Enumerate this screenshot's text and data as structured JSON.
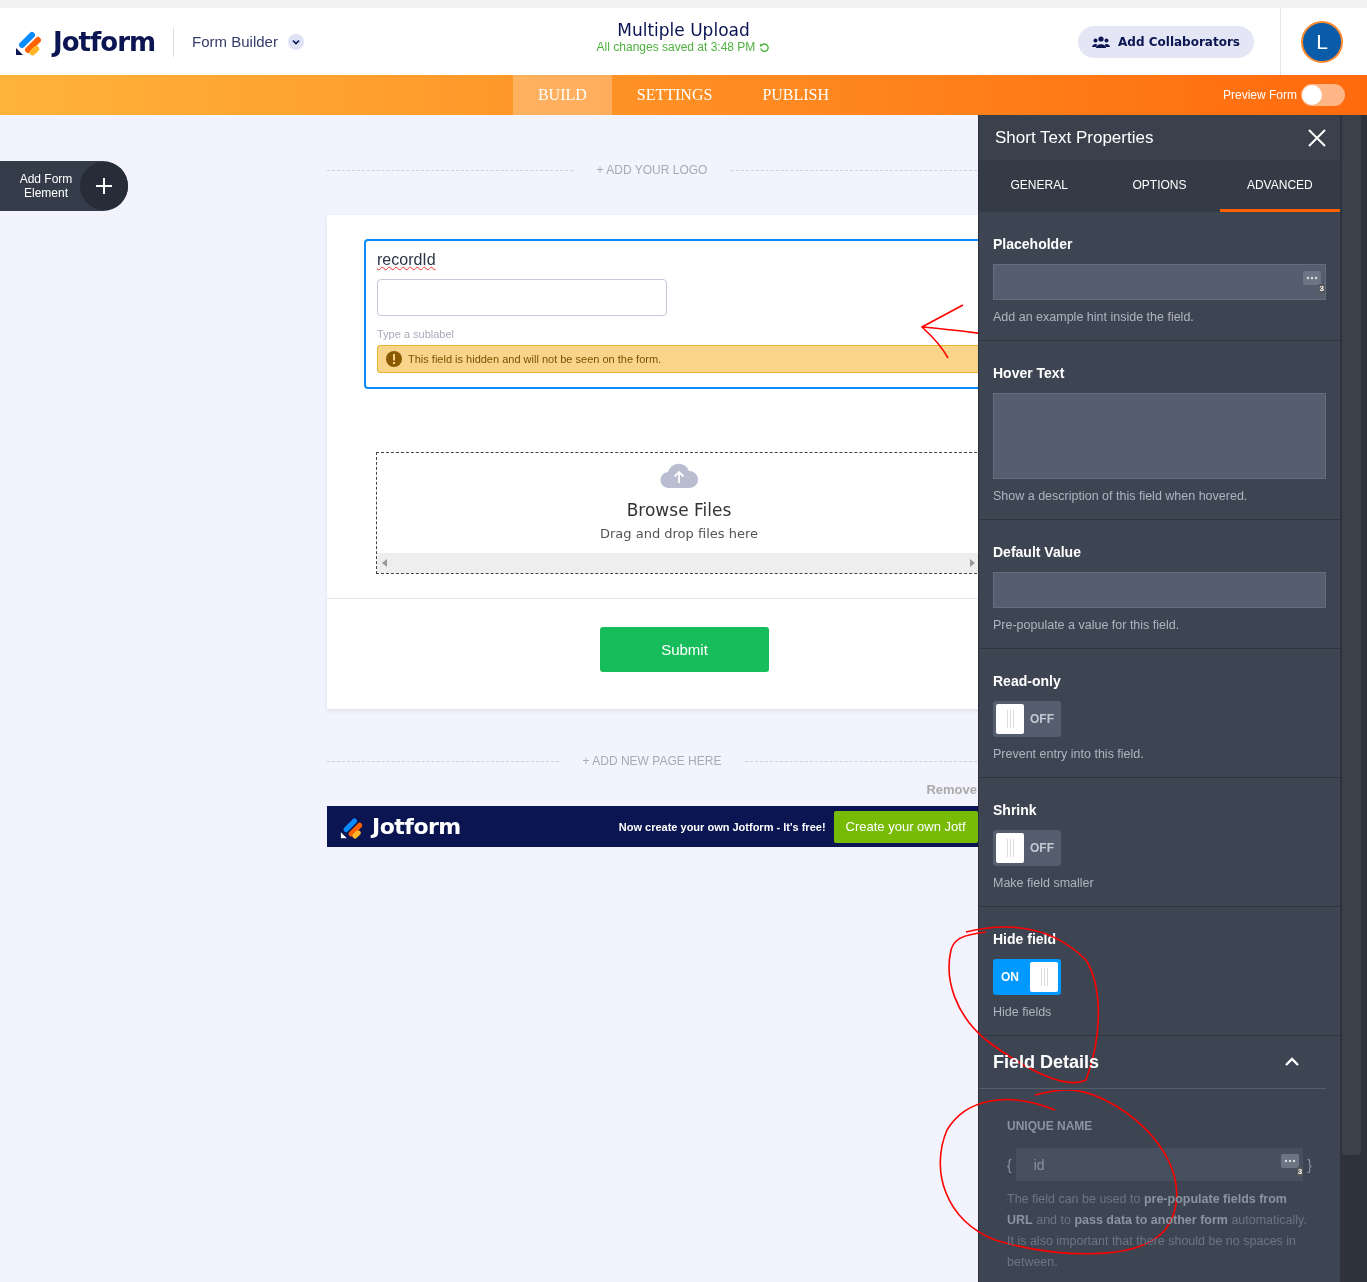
{
  "header": {
    "logo": "Jotform",
    "builder_menu": "Form Builder",
    "title": "Multiple Upload",
    "save_status": "All changes saved at 3:48 PM",
    "collaborators_button": "Add Collaborators",
    "avatar": "L"
  },
  "nav": {
    "tabs": [
      {
        "label": "BUILD",
        "selected": true
      },
      {
        "label": "SETTINGS",
        "selected": false
      },
      {
        "label": "PUBLISH",
        "selected": false
      }
    ],
    "preview": {
      "label": "Preview Form",
      "on": false
    }
  },
  "add_element_button": "Add Form Element",
  "canvas": {
    "add_logo": "+ ADD YOUR LOGO",
    "short_text": {
      "label": "recordId",
      "sublabel_placeholder": "Type a sublabel",
      "hidden_notice": "This field is hidden and will not be seen on the form."
    },
    "upload": {
      "title": "Browse Files",
      "hint": "Drag and drop files here"
    },
    "submit": "Submit",
    "add_page": "+ ADD NEW PAGE HERE",
    "remove_branding": "Remove",
    "banner": {
      "logo": "Jotform",
      "tagline": "Now create your own Jotform - It's free!",
      "button": "Create your own Jotf"
    }
  },
  "panel": {
    "title": "Short Text Properties",
    "tabs": [
      {
        "label": "GENERAL",
        "selected": false
      },
      {
        "label": "OPTIONS",
        "selected": false
      },
      {
        "label": "ADVANCED",
        "selected": true
      }
    ],
    "properties": [
      {
        "kind": "input",
        "label": "Placeholder",
        "hint": "Add an example hint inside the field.",
        "badge": "3"
      },
      {
        "kind": "textarea",
        "label": "Hover Text",
        "hint": "Show a description of this field when hovered."
      },
      {
        "kind": "input",
        "label": "Default Value",
        "hint": "Pre-populate a value for this field."
      },
      {
        "kind": "toggle",
        "label": "Read-only",
        "on": false,
        "state_text": "OFF",
        "hint": "Prevent entry into this field."
      },
      {
        "kind": "toggle",
        "label": "Shrink",
        "on": false,
        "state_text": "OFF",
        "hint": "Make field smaller"
      },
      {
        "kind": "toggle",
        "label": "Hide field",
        "on": true,
        "state_text": "ON",
        "hint": "Hide fields"
      }
    ],
    "field_details": {
      "title": "Field Details",
      "expanded": true,
      "unique_name_label": "UNIQUE NAME",
      "open_brace": "{",
      "value": "id",
      "close_brace": "}",
      "badge": "3",
      "description": "The field can be used to **pre-populate fields from URL** and to **pass data to another form** automatically. It is also important that there should be no spaces in between."
    }
  }
}
